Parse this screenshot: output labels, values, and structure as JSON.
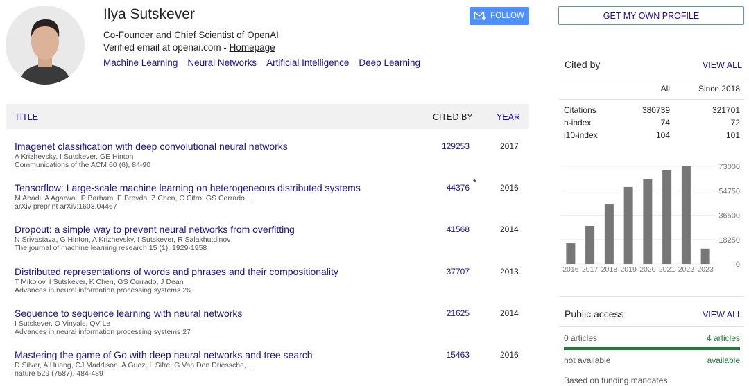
{
  "profile": {
    "name": "Ilya Sutskever",
    "affiliation": "Co-Founder and Chief Scientist of OpenAI",
    "email_text": "Verified email at openai.com -",
    "homepage_label": "Homepage",
    "interests": [
      "Machine Learning",
      "Neural Networks",
      "Artificial Intelligence",
      "Deep Learning"
    ],
    "follow_label": "FOLLOW"
  },
  "table": {
    "title_header": "TITLE",
    "cited_header": "CITED BY",
    "year_header": "YEAR",
    "articles": [
      {
        "title": "Imagenet classification with deep convolutional neural networks",
        "authors": "A Krizhevsky, I Sutskever, GE Hinton",
        "venue": "Communications of the ACM 60 (6), 84-90",
        "cited_by": "129253",
        "star": "",
        "year": "2017"
      },
      {
        "title": "Tensorflow: Large-scale machine learning on heterogeneous distributed systems",
        "authors": "M Abadi, A Agarwal, P Barham, E Brevdo, Z Chen, C Citro, GS Corrado, ...",
        "venue": "arXiv preprint arXiv:1603.04467",
        "cited_by": "44376",
        "star": "*",
        "year": "2016"
      },
      {
        "title": "Dropout: a simple way to prevent neural networks from overfitting",
        "authors": "N Srivastava, G Hinton, A Krizhevsky, I Sutskever, R Salakhutdinov",
        "venue": "The journal of machine learning research 15 (1), 1929-1958",
        "cited_by": "41568",
        "star": "",
        "year": "2014"
      },
      {
        "title": "Distributed representations of words and phrases and their compositionality",
        "authors": "T Mikolov, I Sutskever, K Chen, GS Corrado, J Dean",
        "venue": "Advances in neural information processing systems 26",
        "cited_by": "37707",
        "star": "",
        "year": "2013"
      },
      {
        "title": "Sequence to sequence learning with neural networks",
        "authors": "I Sutskever, O Vinyals, QV Le",
        "venue": "Advances in neural information processing systems 27",
        "cited_by": "21625",
        "star": "",
        "year": "2014"
      },
      {
        "title": "Mastering the game of Go with deep neural networks and tree search",
        "authors": "D Silver, A Huang, CJ Maddison, A Guez, L Sifre, G Van Den Driessche, ...",
        "venue": "nature 529 (7587), 484-489",
        "cited_by": "15463",
        "star": "",
        "year": "2016"
      }
    ]
  },
  "sidebar": {
    "get_profile_label": "GET MY OWN PROFILE",
    "cited_by": {
      "title": "Cited by",
      "view_all": "VIEW ALL",
      "col_all": "All",
      "col_since": "Since 2018",
      "rows": [
        {
          "label": "Citations",
          "all": "380739",
          "since": "321701"
        },
        {
          "label": "h-index",
          "all": "74",
          "since": "72"
        },
        {
          "label": "i10-index",
          "all": "104",
          "since": "101"
        }
      ]
    },
    "public_access": {
      "title": "Public access",
      "view_all": "VIEW ALL",
      "left_count": "0 articles",
      "right_count": "4 articles",
      "left_status": "not available",
      "right_status": "available",
      "note": "Based on funding mandates",
      "available_fraction": 1.0
    }
  },
  "chart_data": {
    "type": "bar",
    "categories": [
      "2016",
      "2017",
      "2018",
      "2019",
      "2020",
      "2021",
      "2022",
      "2023"
    ],
    "values": [
      15500,
      28500,
      44500,
      57500,
      63500,
      70000,
      73000,
      11500
    ],
    "yticks": [
      0,
      18250,
      36500,
      54750,
      73000
    ],
    "ylim": [
      0,
      73000
    ],
    "bar_color": "#777777"
  }
}
